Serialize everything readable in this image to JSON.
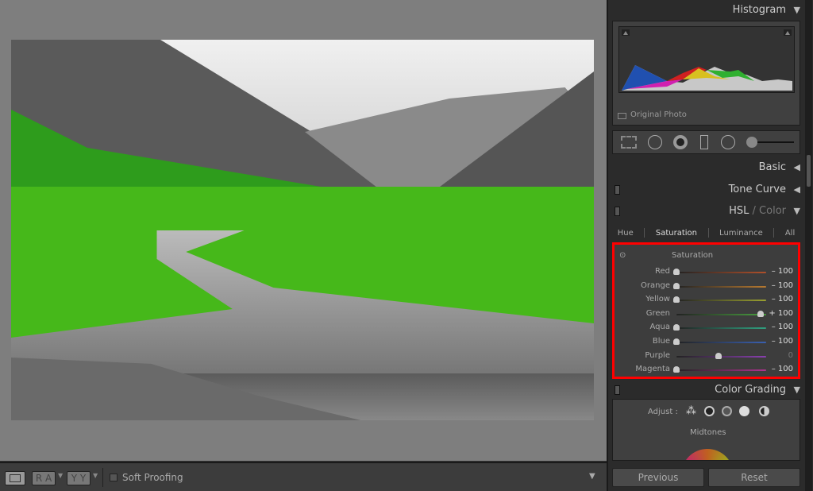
{
  "bottombar": {
    "soft_proofing": "Soft Proofing",
    "compare_ra": "R A",
    "compare_yy": "Y Y"
  },
  "histogram": {
    "title": "Histogram",
    "original_photo": "Original Photo"
  },
  "panels": {
    "basic": "Basic",
    "tone_curve": "Tone Curve",
    "hsl": "HSL",
    "hsl_sep": " / ",
    "color": "Color",
    "color_grading": "Color Grading"
  },
  "hsl_tabs": [
    "Hue",
    "Saturation",
    "Luminance",
    "All"
  ],
  "saturation": {
    "title": "Saturation",
    "rows": [
      {
        "label": "Red",
        "value": "– 100",
        "pos": 0,
        "color": "#b0502a"
      },
      {
        "label": "Orange",
        "value": "– 100",
        "pos": 0,
        "color": "#b87a30"
      },
      {
        "label": "Yellow",
        "value": "– 100",
        "pos": 0,
        "color": "#9aa030"
      },
      {
        "label": "Green",
        "value": "+ 100",
        "pos": 1,
        "color": "#4aa040"
      },
      {
        "label": "Aqua",
        "value": "– 100",
        "pos": 0,
        "color": "#30a080"
      },
      {
        "label": "Blue",
        "value": "– 100",
        "pos": 0,
        "color": "#3a60b0"
      },
      {
        "label": "Purple",
        "value": "0",
        "pos": 0.5,
        "color": "#8a40b0"
      },
      {
        "label": "Magenta",
        "value": "– 100",
        "pos": 0,
        "color": "#b03090"
      }
    ]
  },
  "color_grading": {
    "adjust": "Adjust :",
    "mode": "Midtones"
  },
  "buttons": {
    "previous": "Previous",
    "reset": "Reset"
  }
}
